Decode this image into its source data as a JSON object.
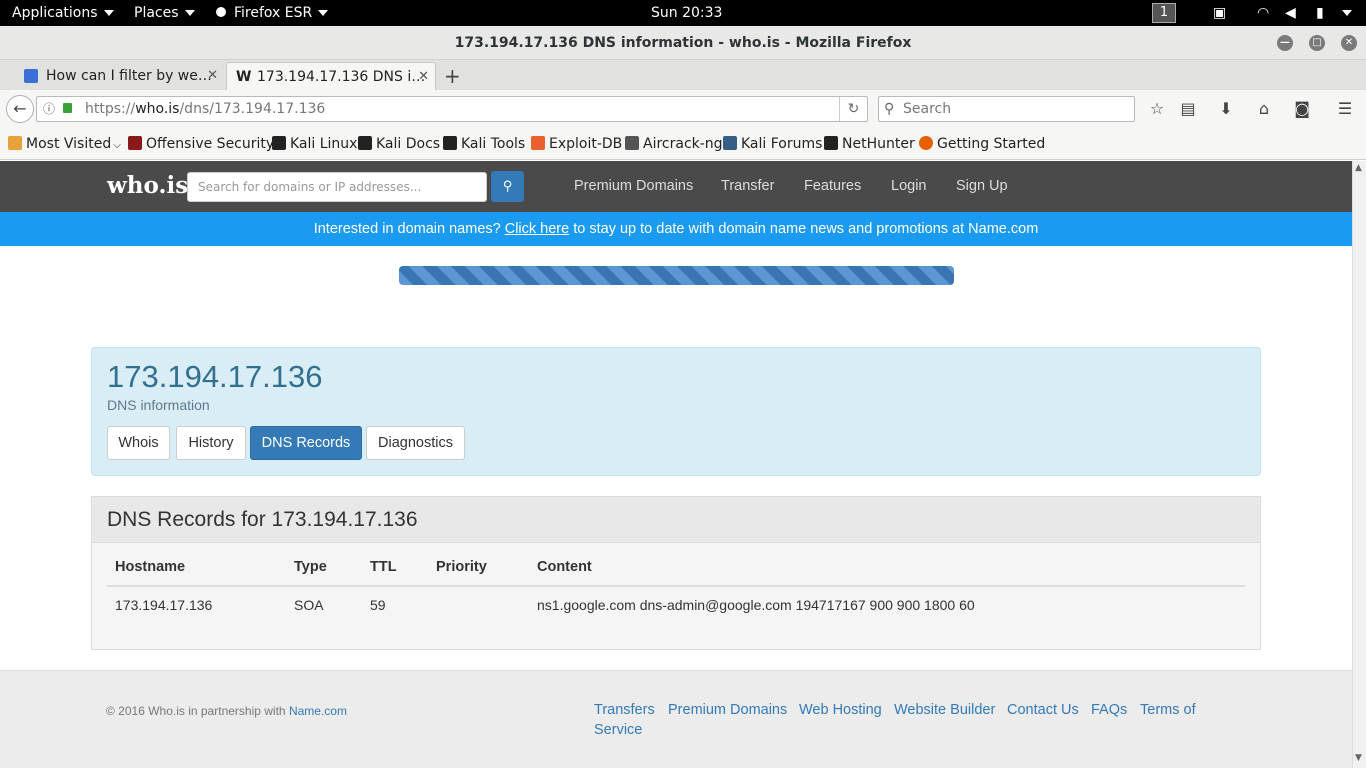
{
  "topbar": {
    "applications": "Applications",
    "places": "Places",
    "app": "Firefox ESR",
    "clock": "Sun 20:33",
    "workspace": "1"
  },
  "window": {
    "title": "173.194.17.136 DNS information - who.is - Mozilla Firefox"
  },
  "tabs": [
    {
      "label": "How can I filter by we…",
      "active": false
    },
    {
      "label": "173.194.17.136 DNS i…",
      "active": true
    }
  ],
  "nav": {
    "url_prefix": "https://",
    "url_domain": "who.is",
    "url_path": "/dns/173.194.17.136",
    "search_placeholder": "Search"
  },
  "bookmarks": [
    {
      "label": "Most Visited",
      "icon": "folder-icon"
    },
    {
      "label": "Offensive Security",
      "icon": "offsec-icon"
    },
    {
      "label": "Kali Linux",
      "icon": "kali-icon"
    },
    {
      "label": "Kali Docs",
      "icon": "kali-icon"
    },
    {
      "label": "Kali Tools",
      "icon": "kali-icon"
    },
    {
      "label": "Exploit-DB",
      "icon": "exploitdb-icon"
    },
    {
      "label": "Aircrack-ng",
      "icon": "aircrack-icon"
    },
    {
      "label": "Kali Forums",
      "icon": "forums-icon"
    },
    {
      "label": "NetHunter",
      "icon": "kali-icon"
    },
    {
      "label": "Getting Started",
      "icon": "firefox-icon"
    }
  ],
  "site": {
    "logo": "who.is",
    "search_placeholder": "Search for domains or IP addresses...",
    "nav": [
      "Premium Domains",
      "Transfer",
      "Features",
      "Login",
      "Sign Up"
    ],
    "promo_before": "Interested in domain names? ",
    "promo_link": "Click here",
    "promo_after": " to stay up to date with domain name news and promotions at Name.com",
    "progress": 1.0
  },
  "header": {
    "ip": "173.194.17.136",
    "subtitle": "DNS information",
    "tabs": [
      "Whois",
      "History",
      "DNS Records",
      "Diagnostics"
    ],
    "active_tab": "DNS Records"
  },
  "records": {
    "title": "DNS Records for 173.194.17.136",
    "columns": [
      "Hostname",
      "Type",
      "TTL",
      "Priority",
      "Content"
    ],
    "rows": [
      {
        "hostname": "173.194.17.136",
        "type": "SOA",
        "ttl": "59",
        "priority": "",
        "content": "ns1.google.com dns-admin@google.com 194717167 900 900 1800 60"
      }
    ]
  },
  "footer": {
    "copyright": "© 2016 Who.is in partnership with ",
    "partner": "Name.com",
    "links": [
      "Transfers",
      "Premium Domains",
      "Web Hosting",
      "Website Builder",
      "Contact Us",
      "FAQs",
      "Terms of",
      "Service"
    ]
  },
  "colors": {
    "accent": "#337ab7",
    "promo": "#1a9af0",
    "sitenav": "#4a4a4a",
    "jumbotron": "#d9edf7"
  }
}
